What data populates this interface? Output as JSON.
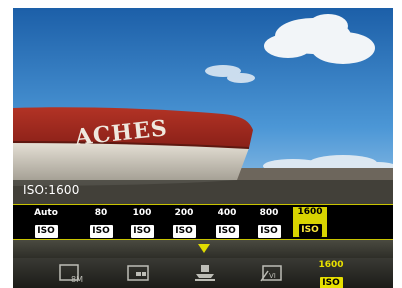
{
  "status": {
    "iso_readout": "ISO:1600"
  },
  "boat": {
    "hull_text": "ACHES"
  },
  "iso_options": [
    {
      "value": "Auto",
      "badge": "ISO",
      "selected": false
    },
    {
      "value": "80",
      "badge": "ISO",
      "selected": false
    },
    {
      "value": "100",
      "badge": "ISO",
      "selected": false
    },
    {
      "value": "200",
      "badge": "ISO",
      "selected": false
    },
    {
      "value": "400",
      "badge": "ISO",
      "selected": false
    },
    {
      "value": "800",
      "badge": "ISO",
      "selected": false
    },
    {
      "value": "1600",
      "badge": "ISO",
      "selected": true
    }
  ],
  "menu": {
    "resolution_label": "8M",
    "iso_value": "1600",
    "iso_badge": "ISO",
    "icons": [
      "resolution-8m-icon",
      "quality-icon",
      "metering-icon",
      "scene-mode-icon",
      "iso-icon"
    ]
  },
  "colors": {
    "accent": "#d8d400",
    "status_bar": "#32322c",
    "sky": "#3f8fd0"
  }
}
